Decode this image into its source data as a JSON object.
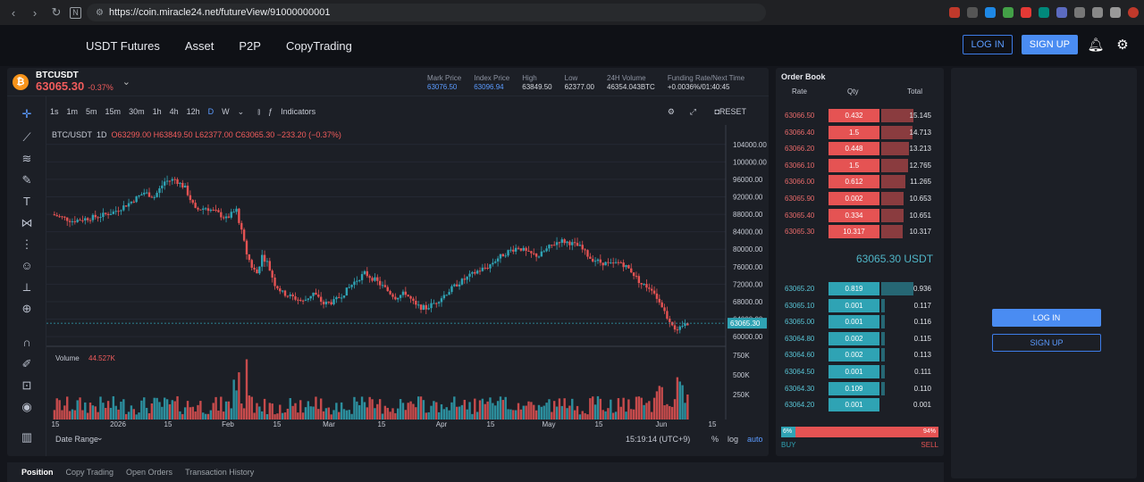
{
  "browser": {
    "url": "https://coin.miracle24.net/futureView/91000000001"
  },
  "nav": {
    "items": [
      "USDT Futures",
      "Asset",
      "P2P",
      "CopyTrading"
    ],
    "login": "LOG IN",
    "signup": "SIGN UP"
  },
  "ticker": {
    "symbol": "BTCUSDT",
    "price": "63065.30",
    "change": "-0.37%",
    "stats": [
      {
        "label": "Mark Price",
        "value": "63076.50"
      },
      {
        "label": "Index Price",
        "value": "63096.94"
      },
      {
        "label": "High",
        "value": "63849.50"
      },
      {
        "label": "Low",
        "value": "62377.00"
      },
      {
        "label": "24H Volume",
        "value": "46354.043BTC"
      },
      {
        "label": "Funding Rate/Next Time",
        "value": "+0.0036%/01:40:45"
      }
    ]
  },
  "toolbar": {
    "intervals": [
      "1s",
      "1m",
      "5m",
      "15m",
      "30m",
      "1h",
      "4h",
      "12h",
      "D",
      "W"
    ],
    "active": "D",
    "indicators": "Indicators",
    "reset": "RESET"
  },
  "legend": {
    "pair": "BTC/USDT",
    "tf": "1D",
    "o": "O63299.00",
    "h": "H63849.50",
    "l": "L62377.00",
    "c": "C63065.30",
    "chg": "−233.20 (−0.37%)",
    "volume_label": "Volume",
    "volume_value": "44.527K"
  },
  "chart_data": {
    "type": "candlestick",
    "price_axis": [
      "104000.00",
      "100000.00",
      "96000.00",
      "92000.00",
      "88000.00",
      "84000.00",
      "80000.00",
      "76000.00",
      "72000.00",
      "68000.00",
      "64000.00",
      "60000.00"
    ],
    "volume_axis": [
      "750K",
      "500K",
      "250K"
    ],
    "x_ticks": [
      "15",
      "2026",
      "15",
      "Feb",
      "15",
      "Mar",
      "15",
      "Apr",
      "15",
      "May",
      "15",
      "Jun",
      "15"
    ],
    "last_price": "63065.30",
    "ylim": [
      59000,
      106000
    ]
  },
  "bottom": {
    "date_range": "Date Range",
    "time": "15:19:14 (UTC+9)",
    "pct": "%",
    "log": "log",
    "auto": "auto"
  },
  "orderbook": {
    "title": "Order Book",
    "headers": [
      "Rate",
      "Qty",
      "Total"
    ],
    "asks": [
      {
        "rate": "63066.50",
        "qty": "0.432",
        "total": "15.145",
        "depth": 1.0
      },
      {
        "rate": "63066.40",
        "qty": "1.5",
        "total": "14.713",
        "depth": 0.97
      },
      {
        "rate": "63066.20",
        "qty": "0.448",
        "total": "13.213",
        "depth": 0.87
      },
      {
        "rate": "63066.10",
        "qty": "1.5",
        "total": "12.765",
        "depth": 0.84
      },
      {
        "rate": "63066.00",
        "qty": "0.612",
        "total": "11.265",
        "depth": 0.74
      },
      {
        "rate": "63065.90",
        "qty": "0.002",
        "total": "10.653",
        "depth": 0.7
      },
      {
        "rate": "63065.40",
        "qty": "0.334",
        "total": "10.651",
        "depth": 0.7
      },
      {
        "rate": "63065.30",
        "qty": "10.317",
        "total": "10.317",
        "depth": 0.68
      }
    ],
    "mid": "63065.30 USDT",
    "bids": [
      {
        "rate": "63065.20",
        "qty": "0.819",
        "total": "0.936",
        "depth": 1.0
      },
      {
        "rate": "63065.10",
        "qty": "0.001",
        "total": "0.117",
        "depth": 0.12
      },
      {
        "rate": "63065.00",
        "qty": "0.001",
        "total": "0.116",
        "depth": 0.12
      },
      {
        "rate": "63064.80",
        "qty": "0.002",
        "total": "0.115",
        "depth": 0.12
      },
      {
        "rate": "63064.60",
        "qty": "0.002",
        "total": "0.113",
        "depth": 0.12
      },
      {
        "rate": "63064.50",
        "qty": "0.001",
        "total": "0.111",
        "depth": 0.12
      },
      {
        "rate": "63064.30",
        "qty": "0.109",
        "total": "0.110",
        "depth": 0.12
      },
      {
        "rate": "63064.20",
        "qty": "0.001",
        "total": "0.001",
        "depth": 0.0
      }
    ],
    "buy_pct": "6%",
    "sell_pct": "94%",
    "buy_label": "BUY",
    "sell_label": "SELL",
    "colors": {
      "ask": "#e55353",
      "bid": "#2fa3b4"
    }
  },
  "side": {
    "login": "LOG IN",
    "signup": "SIGN UP"
  },
  "tabs": [
    "Position",
    "Copy Trading",
    "Open Orders",
    "Transaction History"
  ]
}
